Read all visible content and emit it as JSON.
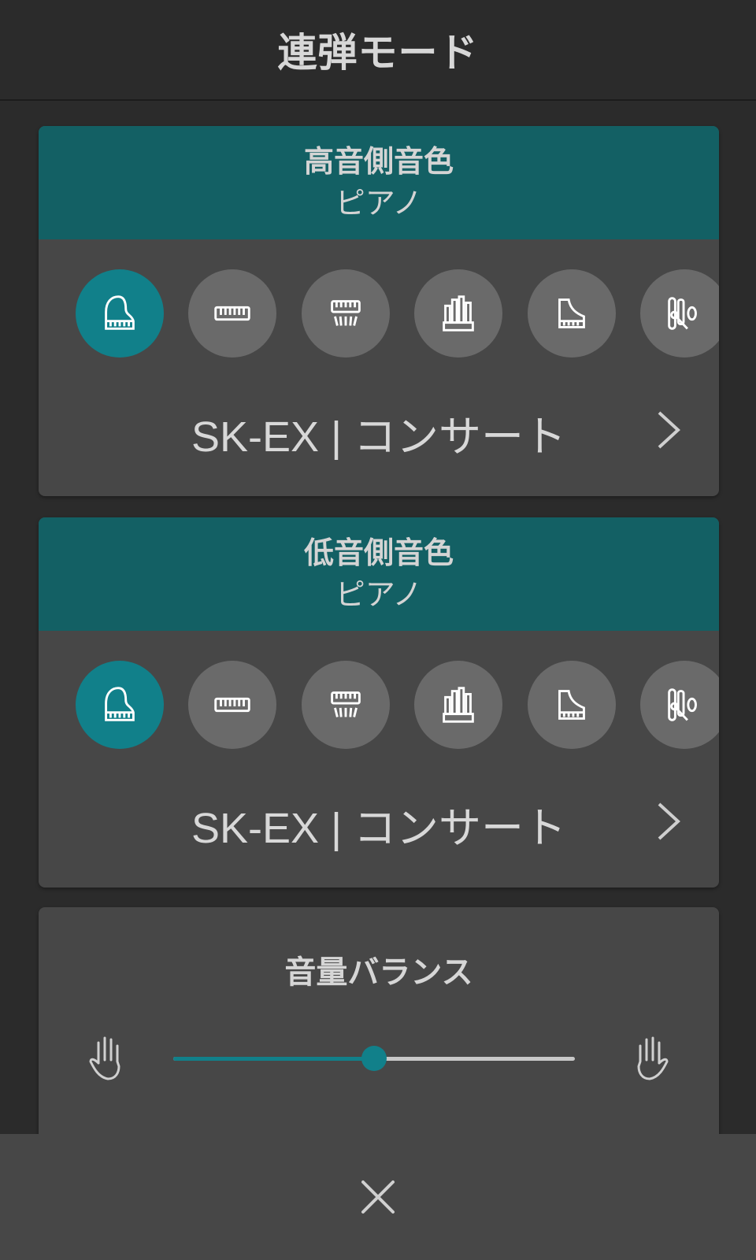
{
  "header": {
    "title": "連弾モード"
  },
  "upper": {
    "label": "高音側音色",
    "category": "ピアノ",
    "voice": "SK-EX | コンサート",
    "categories": [
      "grand-piano-icon",
      "electric-piano-icon",
      "harpsichord-icon",
      "organ-icon",
      "upright-piano-icon",
      "strings-icon"
    ]
  },
  "lower": {
    "label": "低音側音色",
    "category": "ピアノ",
    "voice": "SK-EX | コンサート",
    "categories": [
      "grand-piano-icon",
      "electric-piano-icon",
      "harpsichord-icon",
      "organ-icon",
      "upright-piano-icon",
      "strings-icon"
    ]
  },
  "balance": {
    "title": "音量バランス",
    "value": 0.5
  },
  "colors": {
    "accent": "#11808a",
    "header_band": "#136064",
    "card": "#474747",
    "background": "#2b2b2b"
  }
}
